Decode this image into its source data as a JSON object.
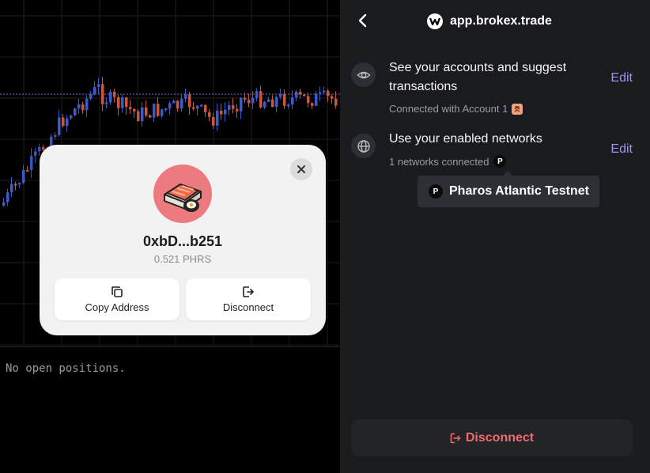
{
  "trading": {
    "empty_positions_text": "No open positions."
  },
  "chart": {
    "colors": {
      "up": "#3b5bcc",
      "down": "#c9563d",
      "grid": "#1f1f1f",
      "price_line": "#6f6fd0"
    }
  },
  "popup": {
    "address": "0xbD...b251",
    "balance": "0.521 PHRS",
    "copy_label": "Copy Address",
    "disconnect_label": "Disconnect",
    "avatar_color": "#ec7a7f"
  },
  "panel": {
    "domain": "app.brokex.trade",
    "permissions": [
      {
        "icon": "eye-icon",
        "title": "See your accounts and suggest transactions",
        "subtitle": "Connected with Account 1",
        "edit_label": "Edit"
      },
      {
        "icon": "globe-icon",
        "title": "Use your enabled networks",
        "subtitle": "1 networks connected",
        "edit_label": "Edit"
      }
    ],
    "network_badge_letter": "P",
    "tooltip": {
      "network_icon_letter": "P",
      "network_name": "Pharos Atlantic Testnet"
    },
    "disconnect_label": "Disconnect",
    "accent_color": "#9a95f5",
    "danger_color": "#f06b6e"
  }
}
